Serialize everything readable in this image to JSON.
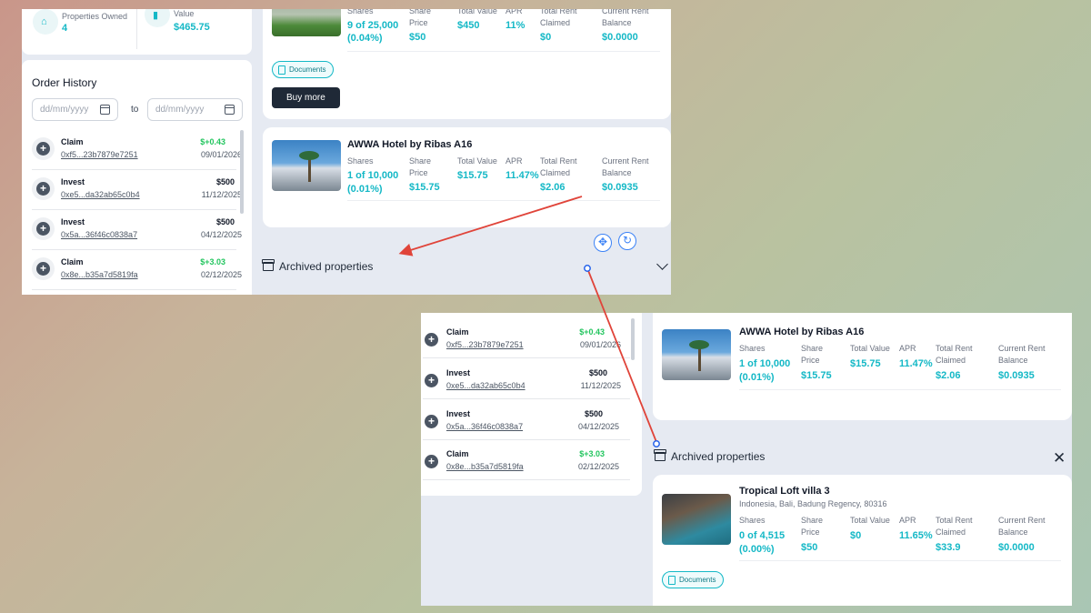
{
  "stats": {
    "properties_owned_label": "Properties Owned",
    "properties_owned_value": "4",
    "total_value_label": "Total Property Value",
    "total_value_value": "$465.75"
  },
  "property_top": {
    "shares_label": "Shares",
    "shares_value": "9 of 25,000",
    "shares_pct": "(0.04%)",
    "share_price_label": "Share Price",
    "share_price_value": "$50",
    "total_value_label": "Total Value",
    "total_value_value": "$450",
    "apr_label": "APR",
    "apr_value": "11%",
    "rent_claimed_label": "Total Rent Claimed",
    "rent_claimed_value": "$0",
    "rent_balance_label": "Current Rent Balance",
    "rent_balance_value": "$0.0000",
    "documents_label": "Documents",
    "buy_more_label": "Buy more"
  },
  "property_awwa": {
    "name": "AWWA Hotel by Ribas A16",
    "shares_label": "Shares",
    "shares_value": "1 of 10,000",
    "shares_pct": "(0.01%)",
    "share_price_label": "Share Price",
    "share_price_value": "$15.75",
    "total_value_label": "Total Value",
    "total_value_value": "$15.75",
    "apr_label": "APR",
    "apr_value": "11.47%",
    "rent_claimed_label": "Total Rent Claimed",
    "rent_claimed_value": "$2.06",
    "rent_balance_label": "Current Rent Balance",
    "rent_balance_value": "$0.0935"
  },
  "property_villa": {
    "name": "Tropical Loft villa 3",
    "address": "Indonesia, Bali, Badung Regency, 80316",
    "shares_label": "Shares",
    "shares_value": "0 of 4,515",
    "shares_pct": "(0.00%)",
    "share_price_label": "Share Price",
    "share_price_value": "$50",
    "total_value_label": "Total Value",
    "total_value_value": "$0",
    "apr_label": "APR",
    "apr_value": "11.65%",
    "rent_claimed_label": "Total Rent Claimed",
    "rent_claimed_value": "$33.9",
    "rent_balance_label": "Current Rent Balance",
    "rent_balance_value": "$0.0000",
    "documents_label": "Documents"
  },
  "order_history": {
    "title": "Order History",
    "date_placeholder": "dd/mm/yyyy",
    "to_label": "to",
    "orders": [
      {
        "type": "Claim",
        "hash": "0xf5...23b7879e7251",
        "amount": "$+0.43",
        "date": "09/01/2026"
      },
      {
        "type": "Invest",
        "hash": "0xe5...da32ab65c0b4",
        "amount": "$500",
        "date": "11/12/2025"
      },
      {
        "type": "Invest",
        "hash": "0x5a...36f46c0838a7",
        "amount": "$500",
        "date": "04/12/2025"
      },
      {
        "type": "Claim",
        "hash": "0x8e...b35a7d5819fa",
        "amount": "$+3.03",
        "date": "02/12/2025"
      }
    ]
  },
  "archived": {
    "label": "Archived properties"
  },
  "colors": {
    "accent": "#14b8c6",
    "positive": "#22c55e",
    "annotation": "#e0443a",
    "panel": "#e6eaf2"
  }
}
